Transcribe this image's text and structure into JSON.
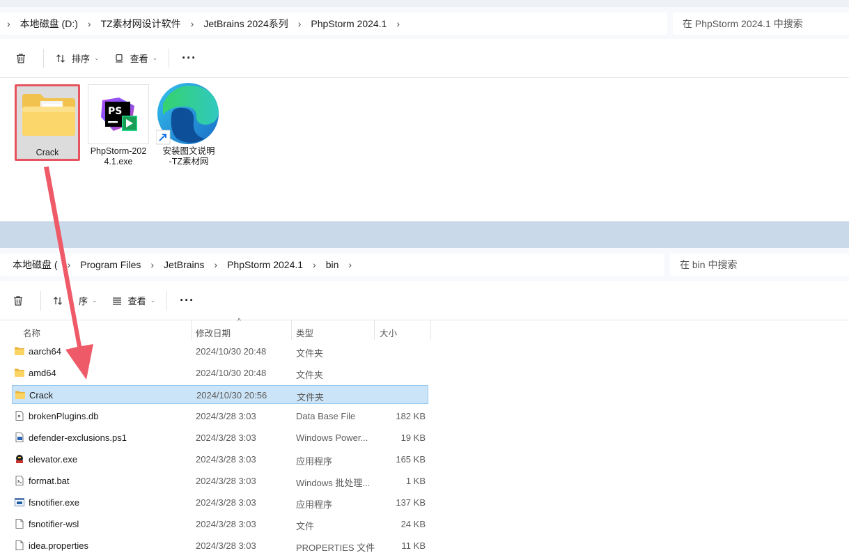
{
  "window1": {
    "breadcrumb": [
      "本地磁盘 (D:)",
      "TZ素材网设计软件",
      "JetBrains 2024系列",
      "PhpStorm 2024.1"
    ],
    "search_placeholder": "在 PhpStorm 2024.1 中搜索",
    "toolbar": {
      "sort_label": "排序",
      "view_label": "查看",
      "more_label": "···"
    },
    "items": [
      {
        "caption": "Crack",
        "icon": "folder-icon",
        "highlighted": true
      },
      {
        "caption": "PhpStorm-2024.1.exe",
        "caption_lines": [
          "PhpStorm-202",
          "4.1.exe"
        ],
        "icon": "phpstorm-icon"
      },
      {
        "caption": "安装图文说明-TZ素材网",
        "caption_lines": [
          "安装图文说明",
          "-TZ素材网"
        ],
        "icon": "edge-shortcut-icon"
      }
    ]
  },
  "window2": {
    "breadcrumb": [
      "本地磁盘 (C:)",
      "Program Files",
      "JetBrains",
      "PhpStorm 2024.1",
      "bin"
    ],
    "breadcrumb_visible": [
      "本地磁盘 (",
      "Program Files",
      "JetBrains",
      "PhpStorm 2024.1",
      "bin"
    ],
    "search_placeholder": "在 bin 中搜索",
    "toolbar": {
      "sort_label": "序",
      "view_label": "查看",
      "more_label": "···"
    },
    "columns": {
      "name": "名称",
      "modified": "修改日期",
      "type": "类型",
      "size": "大小"
    },
    "rows": [
      {
        "name": "aarch64",
        "modified": "2024/10/30 20:48",
        "type": "文件夹",
        "size": "",
        "icon": "folder-icon"
      },
      {
        "name": "amd64",
        "modified": "2024/10/30 20:48",
        "type": "文件夹",
        "size": "",
        "icon": "folder-icon"
      },
      {
        "name": "Crack",
        "modified": "2024/10/30 20:56",
        "type": "文件夹",
        "size": "",
        "icon": "folder-icon",
        "selected": true
      },
      {
        "name": "brokenPlugins.db",
        "modified": "2024/3/28 3:03",
        "type": "Data Base File",
        "size": "182 KB",
        "icon": "db-file-icon"
      },
      {
        "name": "defender-exclusions.ps1",
        "modified": "2024/3/28 3:03",
        "type": "Windows Power...",
        "size": "19 KB",
        "icon": "powershell-file-icon"
      },
      {
        "name": "elevator.exe",
        "modified": "2024/3/28 3:03",
        "type": "应用程序",
        "size": "165 KB",
        "icon": "elevator-exe-icon"
      },
      {
        "name": "format.bat",
        "modified": "2024/3/28 3:03",
        "type": "Windows 批处理...",
        "size": "1 KB",
        "icon": "bat-file-icon"
      },
      {
        "name": "fsnotifier.exe",
        "modified": "2024/3/28 3:03",
        "type": "应用程序",
        "size": "137 KB",
        "icon": "exe-window-icon"
      },
      {
        "name": "fsnotifier-wsl",
        "modified": "2024/3/28 3:03",
        "type": "文件",
        "size": "24 KB",
        "icon": "blank-file-icon"
      },
      {
        "name": "idea.properties",
        "modified": "2024/3/28 3:03",
        "type": "PROPERTIES 文件",
        "size": "11 KB",
        "icon": "blank-file-icon"
      }
    ]
  },
  "colors": {
    "highlight_border": "#e7545f",
    "selection_bg": "#cce4f7",
    "arrow": "#ee5a68"
  }
}
